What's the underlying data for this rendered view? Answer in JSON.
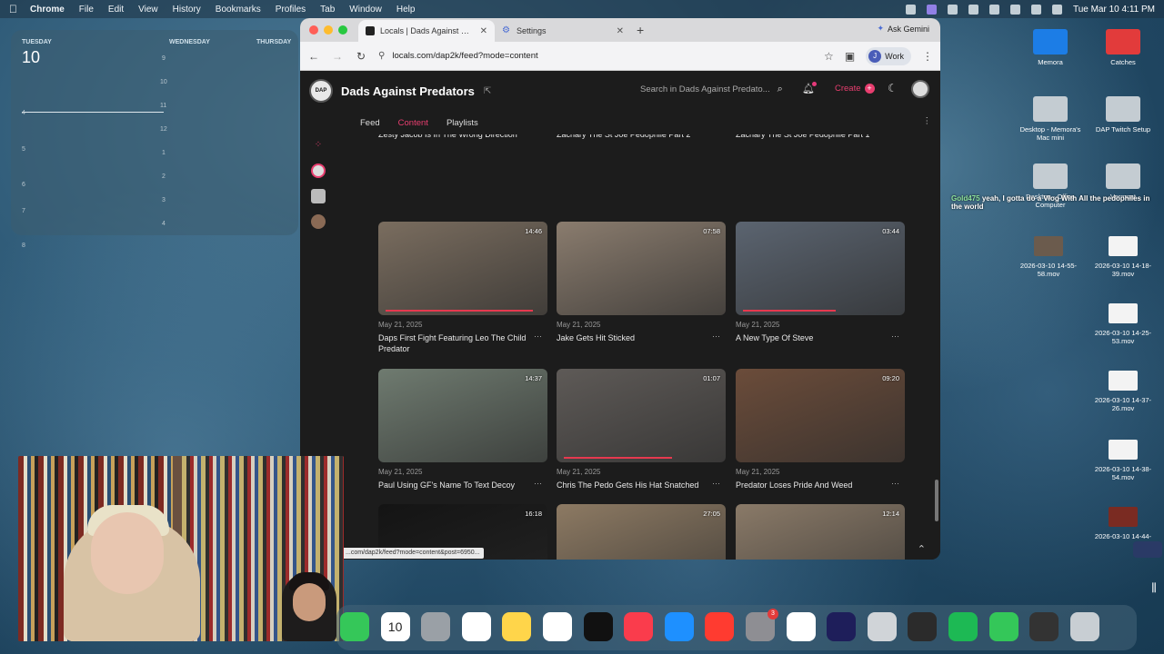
{
  "menubar": {
    "app": "Chrome",
    "items": [
      "File",
      "Edit",
      "View",
      "History",
      "Bookmarks",
      "Profiles",
      "Tab",
      "Window",
      "Help"
    ],
    "clock": "Tue Mar 10  4:11 PM"
  },
  "calendar": {
    "days": [
      "TUESDAY",
      "WEDNESDAY",
      "THURSDAY"
    ],
    "date": "10",
    "col1_ticks": [
      "4",
      "5",
      "6",
      "7",
      "8"
    ],
    "col2_ticks": [
      "9",
      "10",
      "11",
      "12",
      "1",
      "2",
      "3",
      "4"
    ]
  },
  "browser": {
    "tabs": [
      {
        "title": "Locals | Dads Against Predators",
        "icon": "site-favicon"
      },
      {
        "title": "Settings",
        "icon": "gear-icon"
      }
    ],
    "new_tab": "+",
    "gemini": "Ask Gemini",
    "url": "locals.com/dap2k/feed?mode=content",
    "profile": {
      "initial": "J",
      "name": "Work"
    },
    "status_url": "...com/dap2k/feed?mode=content&post=6950..."
  },
  "site": {
    "title": "Dads Against Predators",
    "logo_text": "DAP",
    "search_placeholder": "Search in Dads Against Predato...",
    "create": "Create",
    "subnav": {
      "feed": "Feed",
      "content": "Content",
      "playlists": "Playlists"
    }
  },
  "videos": [
    {
      "date": "May 28, 2025",
      "title": "Zesty Jacob Is In The Wrong Direction",
      "duration": "",
      "color": "#9bbf3a",
      "progress": 1.0
    },
    {
      "date": "May 28, 2025",
      "title": "Zachary The St Joe Pedophile Part 2",
      "duration": "",
      "color": "#c9c26a",
      "progress": 1.0
    },
    {
      "date": "May 28, 2025",
      "title": "Zachary The St Joe Pedophile Part 1",
      "duration": "",
      "color": "#cc9a2a",
      "progress": 0.8
    },
    {
      "date": "May 21, 2025",
      "title": "Daps First Fight Featuring Leo The Child Predator",
      "duration": "14:46",
      "color": "#7a6d5f",
      "progress": 0.95
    },
    {
      "date": "May 21, 2025",
      "title": "Jake Gets Hit Sticked",
      "duration": "07:58",
      "color": "#8a7c6e",
      "progress": 0.0
    },
    {
      "date": "May 21, 2025",
      "title": "A New Type Of Steve",
      "duration": "03:44",
      "color": "#5b6470",
      "progress": 0.6
    },
    {
      "date": "May 21, 2025",
      "title": "Paul Using GF's Name To Text Decoy",
      "duration": "14:37",
      "color": "#6f7b70",
      "progress": 0.0
    },
    {
      "date": "May 21, 2025",
      "title": "Chris The Pedo Gets His Hat Snatched",
      "duration": "01:07",
      "color": "#5e5a57",
      "progress": 0.7
    },
    {
      "date": "May 21, 2025",
      "title": "Predator Loses Pride And Weed",
      "duration": "09:20",
      "color": "#6b4c3a",
      "progress": 0.0
    },
    {
      "date": "",
      "title": "",
      "duration": "16:18",
      "color": "#141414",
      "progress": 0.0
    },
    {
      "date": "",
      "title": "",
      "duration": "27:05",
      "color": "#8d7a63",
      "progress": 0.0
    },
    {
      "date": "",
      "title": "",
      "duration": "12:14",
      "color": "#8a7a68",
      "progress": 0.0
    }
  ],
  "desktop": {
    "items": [
      {
        "label": "Memora",
        "kind": "folder-blue"
      },
      {
        "label": "Catches",
        "kind": "folder-red"
      },
      {
        "label": "Desktop - Memora's Mac mini",
        "kind": "folder"
      },
      {
        "label": "DAP Twitch Setup",
        "kind": "folder"
      },
      {
        "label": "Desktop - Office Computer",
        "kind": "folder"
      },
      {
        "label": "Vermont",
        "kind": "folder"
      },
      {
        "label": "2026-03-10 14-55-58.mov",
        "kind": "video"
      },
      {
        "label": "2026-03-10 14-18-39.mov",
        "kind": "file"
      },
      {
        "label": "2026-03-10 14-25-53.mov",
        "kind": "file"
      },
      {
        "label": "2026-03-10 14-37-26.mov",
        "kind": "file"
      },
      {
        "label": "2026-03-10 14-38-54.mov",
        "kind": "file"
      },
      {
        "label": "2026-03-10 14-44-",
        "kind": "file-red"
      }
    ],
    "chat": {
      "user": "Gold475",
      "message": "yeah, I gotta do a Vlog With All the pedophiles in the world"
    }
  },
  "dock": {
    "apps": [
      "Messages",
      "Calendar",
      "Contacts",
      "Reminders",
      "Notes",
      "Freeform",
      "Apple TV",
      "Music",
      "App Store",
      "News",
      "System Settings",
      "Chrome",
      "Premiere Pro",
      "Screenshot",
      "OBS",
      "Spotify",
      "Phone",
      "Terminal",
      "Trash"
    ],
    "calendar_day": "10",
    "settings_badge": "3"
  }
}
